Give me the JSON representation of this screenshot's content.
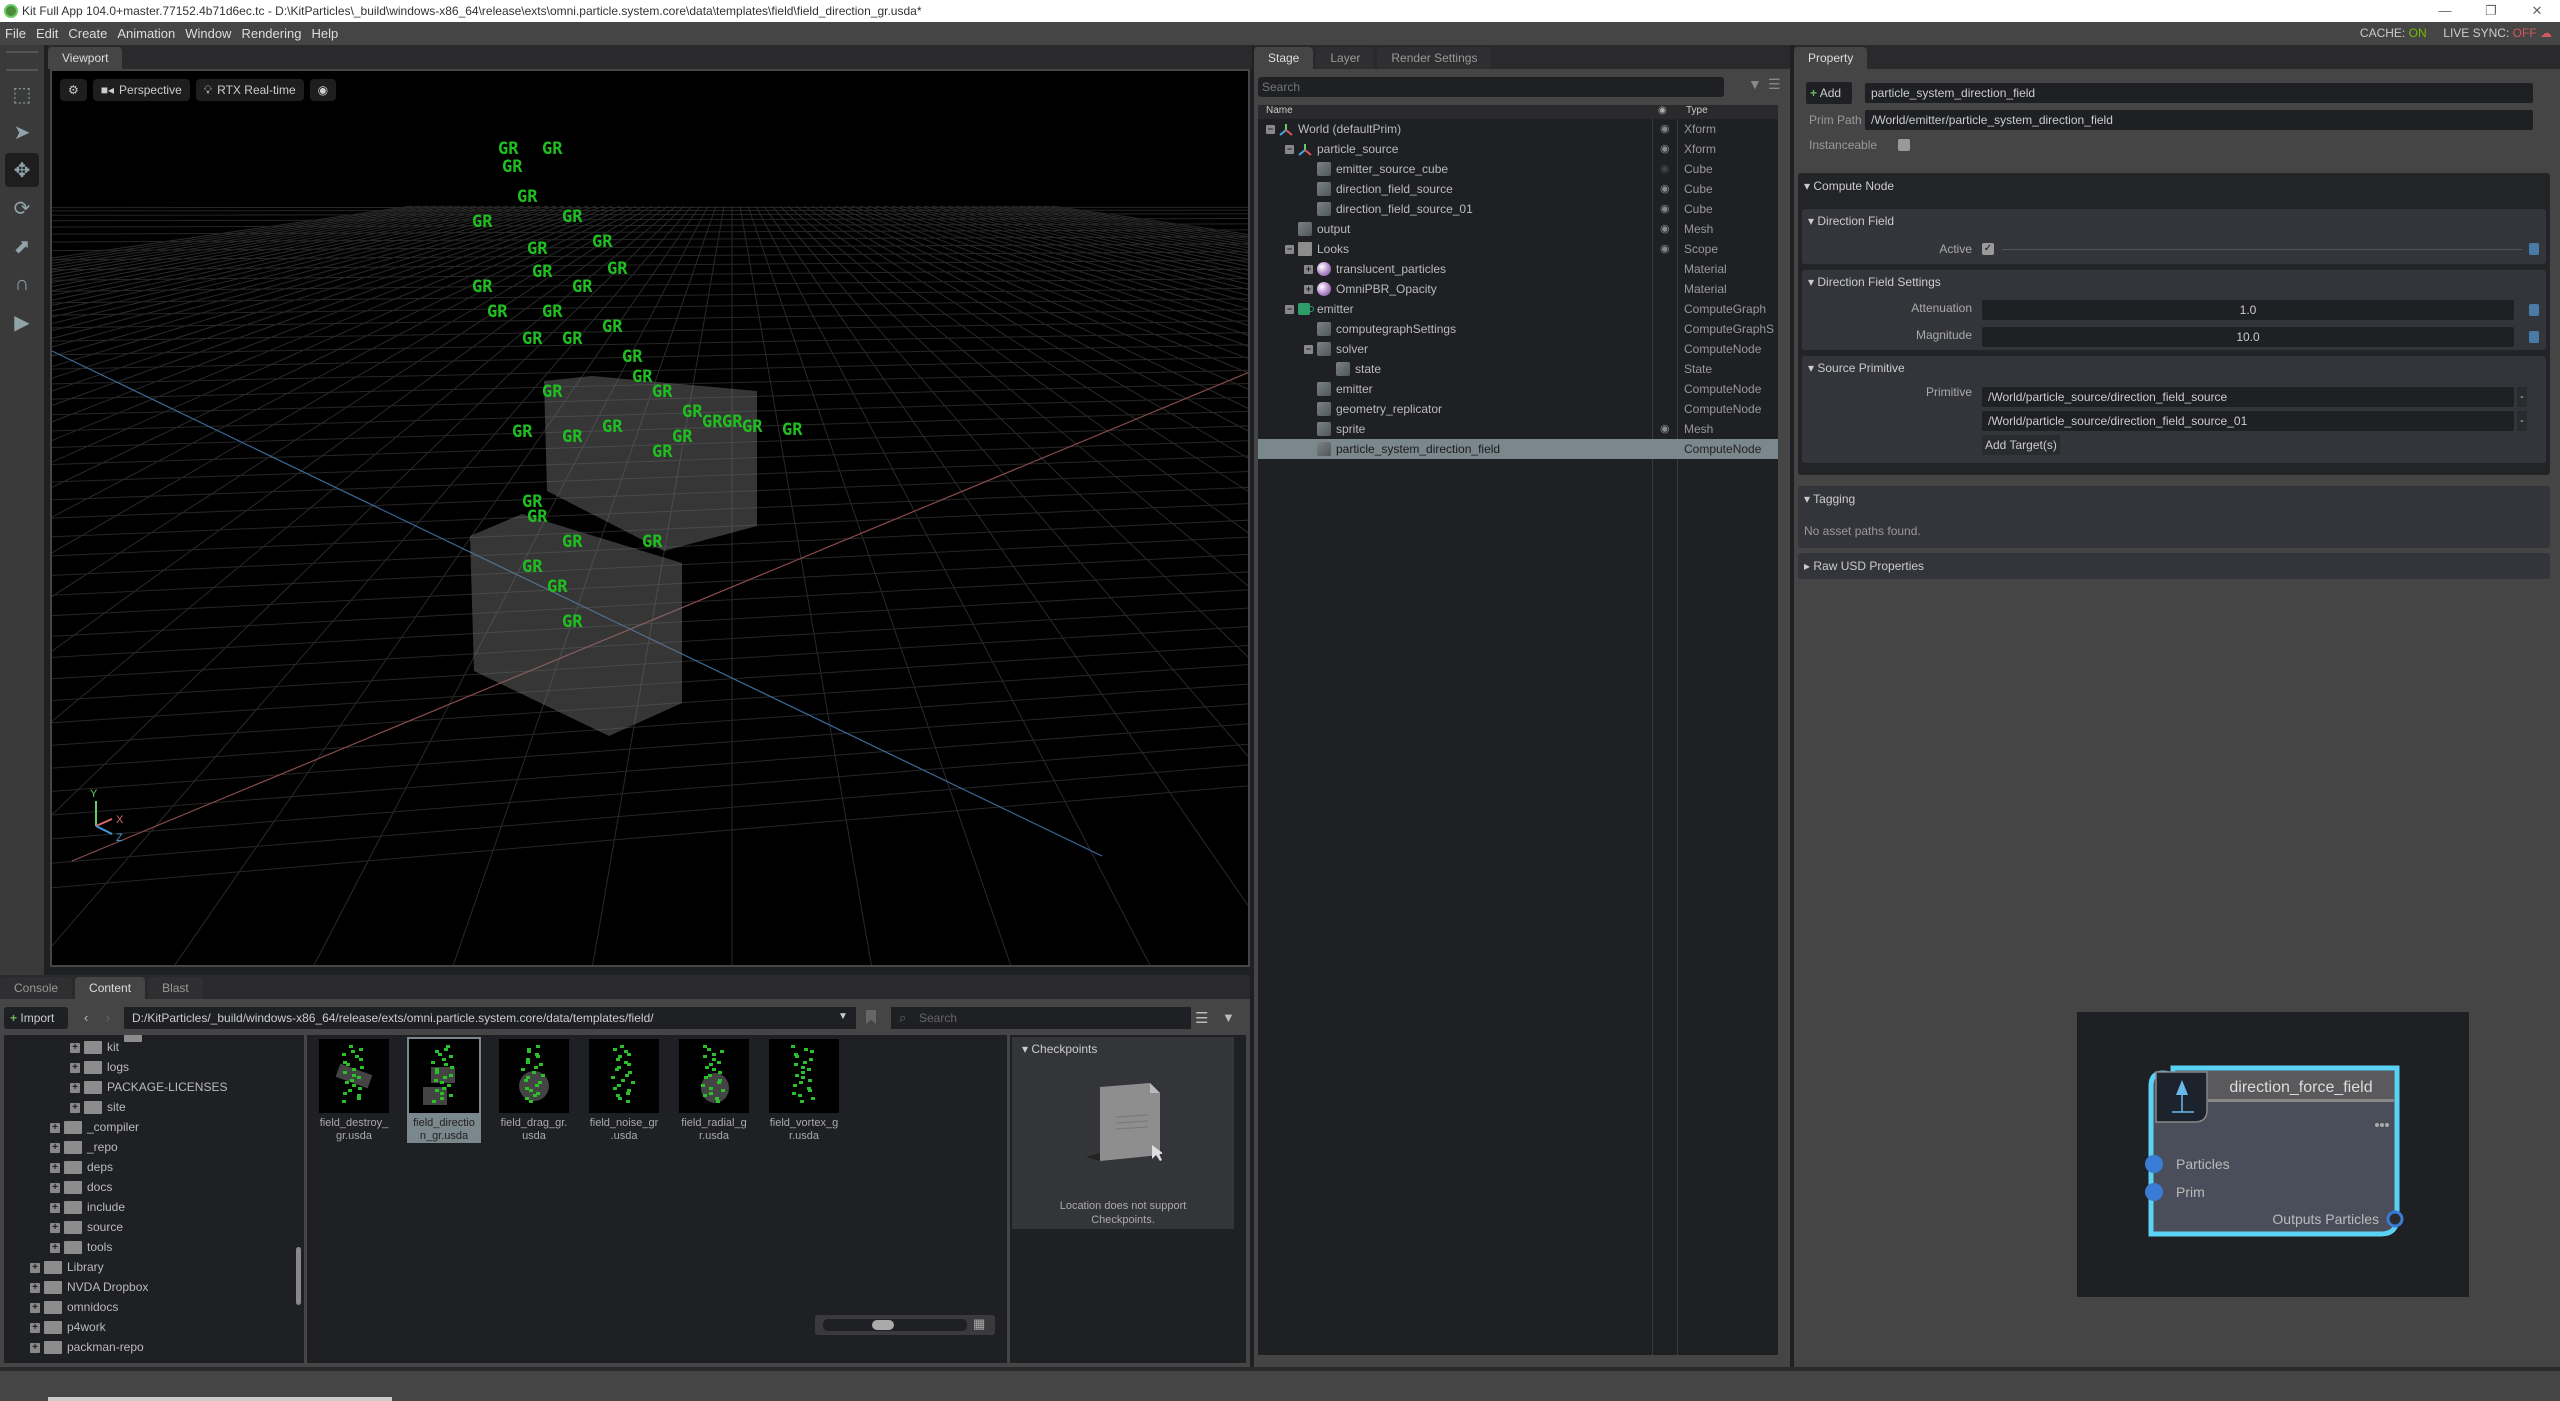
{
  "window": {
    "title": "Kit Full App 104.0+master.77152.4b71d6ec.tc - D:\\KitParticles\\_build\\windows-x86_64\\release\\exts\\omni.particle.system.core\\data\\templates\\field\\field_direction_gr.usda*",
    "controls": {
      "minimize": "—",
      "restore": "❐",
      "close": "✕"
    }
  },
  "menu": {
    "items": [
      "File",
      "Edit",
      "Create",
      "Animation",
      "Window",
      "Rendering",
      "Help"
    ],
    "cache_label": "CACHE:",
    "cache_value": "ON",
    "livesync_label": "LIVE SYNC:",
    "livesync_value": "OFF"
  },
  "left_toolbar": {
    "tools": [
      {
        "name": "frame-selection-icon",
        "glyph": "⬚"
      },
      {
        "name": "select-arrow-icon",
        "glyph": "➤"
      },
      {
        "name": "move-icon",
        "glyph": "✥",
        "active": true
      },
      {
        "name": "rotate-icon",
        "glyph": "⟳"
      },
      {
        "name": "scale-icon",
        "glyph": "⬈"
      },
      {
        "name": "snap-magnet-icon",
        "glyph": "∩"
      },
      {
        "name": "play-icon",
        "glyph": "▶"
      }
    ]
  },
  "viewport": {
    "tab": "Viewport",
    "camera_label": "Perspective",
    "renderer_label": "RTX Real-time",
    "particle_label": "GR",
    "axes": {
      "y": "Y",
      "x": "X",
      "z": "Z"
    }
  },
  "stage": {
    "tabs": [
      "Stage",
      "Layer",
      "Render Settings"
    ],
    "active_tab": "Stage",
    "search_placeholder": "Search",
    "col_name": "Name",
    "col_type": "Type",
    "rows": [
      {
        "name": "World (defaultPrim)",
        "type": "Xform",
        "depth": 0,
        "icon": "xform",
        "expand": "-",
        "eye": true
      },
      {
        "name": "particle_source",
        "type": "Xform",
        "depth": 1,
        "icon": "xform",
        "expand": "-",
        "eye": true
      },
      {
        "name": "emitter_source_cube",
        "type": "Cube",
        "depth": 2,
        "icon": "cube",
        "expand": "",
        "eye": "hidden"
      },
      {
        "name": "direction_field_source",
        "type": "Cube",
        "depth": 2,
        "icon": "cube",
        "expand": "",
        "eye": true
      },
      {
        "name": "direction_field_source_01",
        "type": "Cube",
        "depth": 2,
        "icon": "cube",
        "expand": "",
        "eye": true
      },
      {
        "name": "output",
        "type": "Mesh",
        "depth": 1,
        "icon": "cube",
        "expand": "",
        "eye": true
      },
      {
        "name": "Looks",
        "type": "Scope",
        "depth": 1,
        "icon": "folder",
        "expand": "-",
        "eye": true
      },
      {
        "name": "translucent_particles",
        "type": "Material",
        "depth": 2,
        "icon": "sphere",
        "expand": "+",
        "eye": false
      },
      {
        "name": "OmniPBR_Opacity",
        "type": "Material",
        "depth": 2,
        "icon": "sphere",
        "expand": "+",
        "eye": false
      },
      {
        "name": "emitter",
        "type": "ComputeGraph",
        "depth": 1,
        "icon": "graph",
        "expand": "-",
        "eye": false
      },
      {
        "name": "computegraphSettings",
        "type": "ComputeGraphSe",
        "depth": 2,
        "icon": "cube",
        "expand": "",
        "eye": false
      },
      {
        "name": "solver",
        "type": "ComputeNode",
        "depth": 2,
        "icon": "cube",
        "expand": "-",
        "eye": false
      },
      {
        "name": "state",
        "type": "State",
        "depth": 3,
        "icon": "cube",
        "expand": "",
        "eye": false
      },
      {
        "name": "emitter",
        "type": "ComputeNode",
        "depth": 2,
        "icon": "cube",
        "expand": "",
        "eye": false
      },
      {
        "name": "geometry_replicator",
        "type": "ComputeNode",
        "depth": 2,
        "icon": "cube",
        "expand": "",
        "eye": false
      },
      {
        "name": "sprite",
        "type": "Mesh",
        "depth": 2,
        "icon": "cube",
        "expand": "",
        "eye": true
      },
      {
        "name": "particle_system_direction_field",
        "type": "ComputeNode",
        "depth": 2,
        "icon": "cube",
        "expand": "",
        "eye": false,
        "selected": true
      }
    ]
  },
  "property": {
    "tab": "Property",
    "add_label": "Add",
    "prim_name": "particle_system_direction_field",
    "prim_path_label": "Prim Path",
    "prim_path": "/World/emitter/particle_system_direction_field",
    "instanceable_label": "Instanceable",
    "instanceable": false,
    "compute_node_title": "Compute Node",
    "direction_field_title": "Direction Field",
    "active_label": "Active",
    "active": true,
    "settings_title": "Direction Field Settings",
    "attenuation_label": "Attenuation",
    "attenuation": "1.0",
    "magnitude_label": "Magnitude",
    "magnitude": "10.0",
    "source_title": "Source Primitive",
    "primitive_label": "Primitive",
    "primitives": [
      "/World/particle_source/direction_field_source",
      "/World/particle_source/direction_field_source_01"
    ],
    "remove_label": "-",
    "add_target_label": "Add Target(s)",
    "tagging_title": "Tagging",
    "tagging_msg": "No asset paths found.",
    "raw_usd_title": "Raw USD Properties"
  },
  "content": {
    "tabs": [
      "Console",
      "Content",
      "Blast"
    ],
    "active_tab": "Content",
    "import_label": "Import",
    "path": "D:/KitParticles/_build/windows-x86_64/release/exts/omni.particle.system.core/data/templates/field/",
    "search_placeholder": "Search",
    "tree": [
      {
        "name": "kit",
        "depth": 2
      },
      {
        "name": "logs",
        "depth": 2
      },
      {
        "name": "PACKAGE-LICENSES",
        "depth": 2
      },
      {
        "name": "site",
        "depth": 2
      },
      {
        "name": "_compiler",
        "depth": 1
      },
      {
        "name": "_repo",
        "depth": 1
      },
      {
        "name": "deps",
        "depth": 1
      },
      {
        "name": "docs",
        "depth": 1
      },
      {
        "name": "include",
        "depth": 1
      },
      {
        "name": "source",
        "depth": 1
      },
      {
        "name": "tools",
        "depth": 1
      },
      {
        "name": "Library",
        "depth": 0
      },
      {
        "name": "NVDA Dropbox",
        "depth": 0
      },
      {
        "name": "omnidocs",
        "depth": 0
      },
      {
        "name": "p4work",
        "depth": 0
      },
      {
        "name": "packman-repo",
        "depth": 0
      }
    ],
    "files": [
      {
        "line1": "field_destroy_",
        "line2": "gr.usda"
      },
      {
        "line1": "field_directio",
        "line2": "n_gr.usda",
        "selected": true
      },
      {
        "line1": "field_drag_gr.",
        "line2": "usda"
      },
      {
        "line1": "field_noise_gr",
        "line2": ".usda"
      },
      {
        "line1": "field_radial_g",
        "line2": "r.usda"
      },
      {
        "line1": "field_vortex_g",
        "line2": "r.usda"
      }
    ],
    "checkpoints_title": "Checkpoints",
    "checkpoints_msg_1": "Location does not support",
    "checkpoints_msg_2": "Checkpoints."
  },
  "graph_node": {
    "title": "direction_force_field",
    "inputs": [
      "Particles",
      "Prim"
    ],
    "output": "Outputs Particles",
    "accent": "#5ad2f4",
    "port_color": "#3a7bd5"
  }
}
